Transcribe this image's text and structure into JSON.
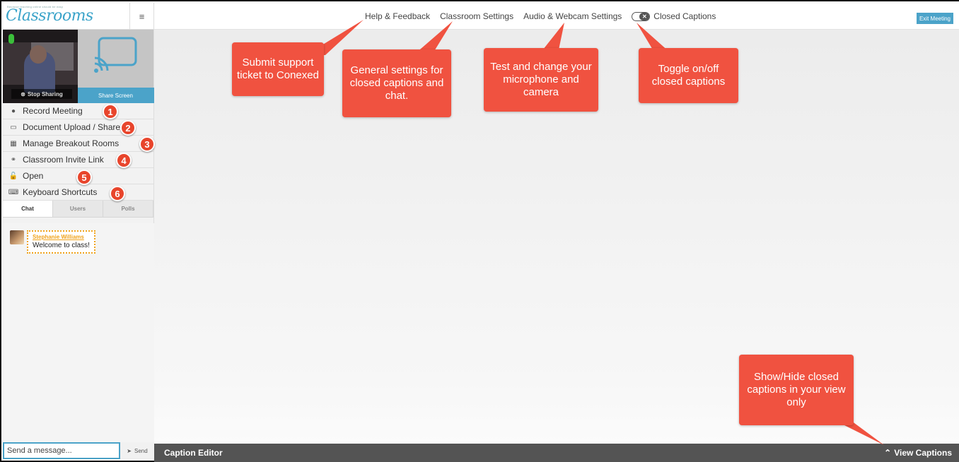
{
  "app": {
    "logo_tagline": "Because teaching online should be easy",
    "logo_text": "Classrooms",
    "menu_icon": "hamburger-icon"
  },
  "media": {
    "stop_sharing_label": "Stop Sharing",
    "share_screen_label": "Share Screen"
  },
  "sidebar": {
    "items": [
      {
        "icon": "●",
        "label": "Record Meeting",
        "badge": "1"
      },
      {
        "icon": "▭",
        "label": "Document Upload / Share",
        "badge": "2"
      },
      {
        "icon": "▦",
        "label": "Manage Breakout Rooms",
        "badge": "3"
      },
      {
        "icon": "⚭",
        "label": "Classroom Invite Link",
        "badge": "4"
      },
      {
        "icon": "🔓",
        "label": "Open",
        "badge": "5"
      },
      {
        "icon": "⌨",
        "label": "Keyboard Shortcuts",
        "badge": "6"
      }
    ],
    "tabs": [
      "Chat",
      "Users",
      "Polls"
    ]
  },
  "chat": {
    "messages": [
      {
        "author": "Stephanie Williams",
        "text": "Welcome to class!"
      }
    ],
    "input_placeholder": "Send a message...",
    "send_label": "Send"
  },
  "topbar": {
    "help": "Help & Feedback",
    "classroom_settings": "Classroom Settings",
    "av_settings": "Audio & Webcam Settings",
    "closed_captions": "Closed Captions",
    "exit": "Exit Meeting"
  },
  "caption_bar": {
    "editor": "Caption Editor",
    "view": "View Captions"
  },
  "callouts": {
    "support": "Submit support ticket to Conexed",
    "general": "General settings for closed captions and chat.",
    "test": "Test and change your microphone and camera",
    "toggle": "Toggle on/off closed captions",
    "show_hide": "Show/Hide closed captions in your view only"
  },
  "colors": {
    "accent": "#4ba3c9",
    "callout": "#f05240",
    "chat_author": "#f0a31c",
    "caption_bar": "#545454"
  }
}
